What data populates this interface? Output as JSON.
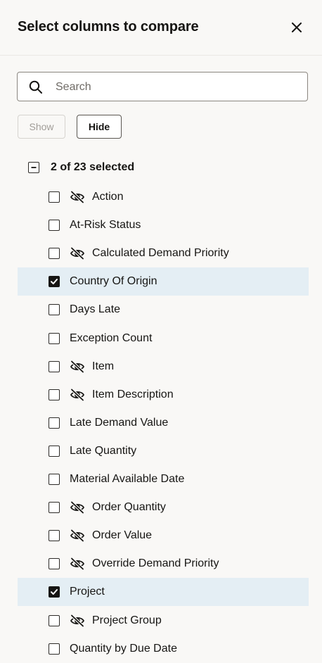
{
  "dialog": {
    "title": "Select columns to compare"
  },
  "search": {
    "placeholder": "Search",
    "value": ""
  },
  "actions": {
    "show_label": "Show",
    "hide_label": "Hide"
  },
  "selection": {
    "summary": "2 of 23 selected"
  },
  "columns": [
    {
      "label": "Action",
      "hidden": true,
      "checked": false
    },
    {
      "label": "At-Risk Status",
      "hidden": false,
      "checked": false
    },
    {
      "label": "Calculated Demand Priority",
      "hidden": true,
      "checked": false
    },
    {
      "label": "Country Of Origin",
      "hidden": false,
      "checked": true
    },
    {
      "label": "Days Late",
      "hidden": false,
      "checked": false
    },
    {
      "label": "Exception Count",
      "hidden": false,
      "checked": false
    },
    {
      "label": "Item",
      "hidden": true,
      "checked": false
    },
    {
      "label": "Item Description",
      "hidden": true,
      "checked": false
    },
    {
      "label": "Late Demand Value",
      "hidden": false,
      "checked": false
    },
    {
      "label": "Late Quantity",
      "hidden": false,
      "checked": false
    },
    {
      "label": "Material Available Date",
      "hidden": false,
      "checked": false
    },
    {
      "label": "Order Quantity",
      "hidden": true,
      "checked": false
    },
    {
      "label": "Order Value",
      "hidden": true,
      "checked": false
    },
    {
      "label": "Override Demand Priority",
      "hidden": true,
      "checked": false
    },
    {
      "label": "Project",
      "hidden": false,
      "checked": true
    },
    {
      "label": "Project Group",
      "hidden": true,
      "checked": false
    },
    {
      "label": "Quantity by Due Date",
      "hidden": false,
      "checked": false
    }
  ],
  "icons": {
    "close": "close-icon",
    "search": "search-icon",
    "hidden": "eye-slash-icon",
    "checkbox_mixed": "minus-icon",
    "checkbox_checked": "checkmark-icon"
  },
  "colors": {
    "background": "#f9f8f6",
    "selected_row": "#e4eef4",
    "text": "#161513"
  }
}
